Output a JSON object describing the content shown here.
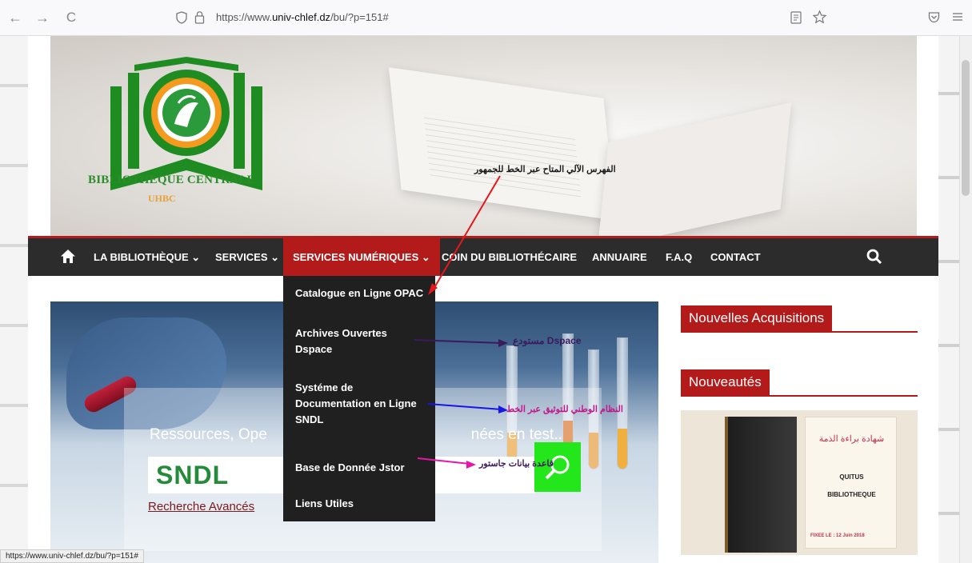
{
  "browser": {
    "url_prefix": "https://www.",
    "url_domain": "univ-chlef.dz",
    "url_suffix": "/bu/?p=151#",
    "back_icon": "←",
    "forward_icon": "→",
    "reload_icon": "C"
  },
  "header": {
    "logo_title": "BIBLIOTHEQUE CENTRALE",
    "logo_sub": "UHBC",
    "annotation_opac": "الفهرس الآلي المتاح عبر الخط للجمهور"
  },
  "nav": {
    "items": [
      {
        "label": "LA BIBLIOTHÈQUE ⌄"
      },
      {
        "label": "SERVICES ⌄"
      },
      {
        "label": "SERVICES NUMÉRIQUES ⌄"
      },
      {
        "label": "COIN DU BIBLIOTHÉCAIRE"
      },
      {
        "label": "ANNUAIRE"
      },
      {
        "label": "F.A.Q"
      },
      {
        "label": "CONTACT"
      }
    ]
  },
  "dropdown": {
    "items": [
      {
        "label": "Catalogue en Ligne OPAC"
      },
      {
        "label": "Archives Ouvertes Dspace"
      },
      {
        "label": "Systéme de Documentation en Ligne SNDL"
      },
      {
        "label": "Base de Donnée Jstor"
      },
      {
        "label": "Liens Utiles"
      }
    ]
  },
  "annotations": {
    "dspace": "مستودع Dspace",
    "sndl": "النظام الوطني للتوثيق عبر الخط",
    "jstor": "قاعدة بيانات جاستور"
  },
  "hero": {
    "tagline": "Ressources, Ope",
    "tagline_end": "nées en test..",
    "search_value": "SNDL",
    "advanced_link": "Recherche Avancés"
  },
  "sidebar": {
    "widget1": "Nouvelles Acquisitions",
    "widget2": "Nouveautés",
    "book_ar": "شهادة براءة الذمة",
    "book_title1": "QUITUS",
    "book_title2": "BIBLIOTHEQUE",
    "book_footer": "FIXEE LE : 12 Juin 2018"
  },
  "status": {
    "hover_url": "https://www.univ-chlef.dz/bu/?p=151#"
  },
  "colors": {
    "accent": "#b31b1b",
    "nav_bg": "#2c2c2c",
    "search_green": "#23e61b",
    "logo_green": "#2a8c2a"
  }
}
